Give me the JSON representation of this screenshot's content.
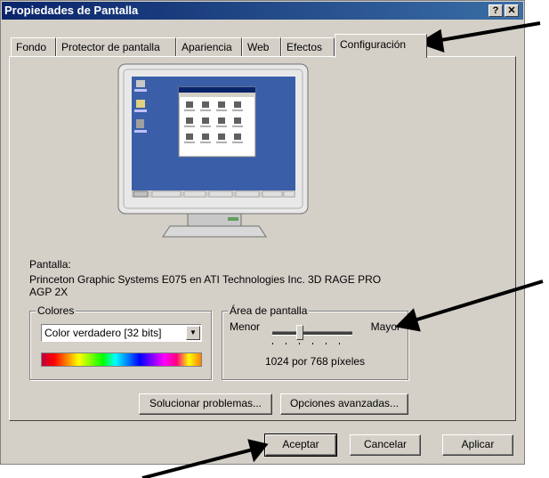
{
  "window": {
    "title": "Propiedades de Pantalla",
    "help_label": "?",
    "close_label": "✕"
  },
  "tabs": [
    {
      "label": "Fondo"
    },
    {
      "label": "Protector de pantalla"
    },
    {
      "label": "Apariencia"
    },
    {
      "label": "Web"
    },
    {
      "label": "Efectos"
    },
    {
      "label": "Configuración"
    }
  ],
  "display": {
    "label": "Pantalla:",
    "device_line1": "Princeton Graphic Systems E075 en ATI Technologies Inc. 3D RAGE PRO",
    "device_line2": "AGP 2X"
  },
  "colors": {
    "group_label": "Colores",
    "selected": "Color verdadero [32 bits]"
  },
  "screen_area": {
    "group_label": "Área de pantalla",
    "min_label": "Menor",
    "max_label": "Mayor",
    "value_text": "1024 por 768 píxeles",
    "slider_level": 0.33
  },
  "buttons": {
    "troubleshoot": "Solucionar problemas...",
    "advanced": "Opciones avanzadas...",
    "ok": "Aceptar",
    "cancel": "Cancelar",
    "apply": "Aplicar"
  },
  "preview": {
    "desktop_icons": [
      "Mi PC",
      "Mis documentos",
      "Papelera"
    ],
    "taskbar_start": "Inicio"
  },
  "theme": {
    "titlebar": "#0a246a",
    "desktop": "#3a5fa8",
    "face": "#d4d0c8"
  }
}
